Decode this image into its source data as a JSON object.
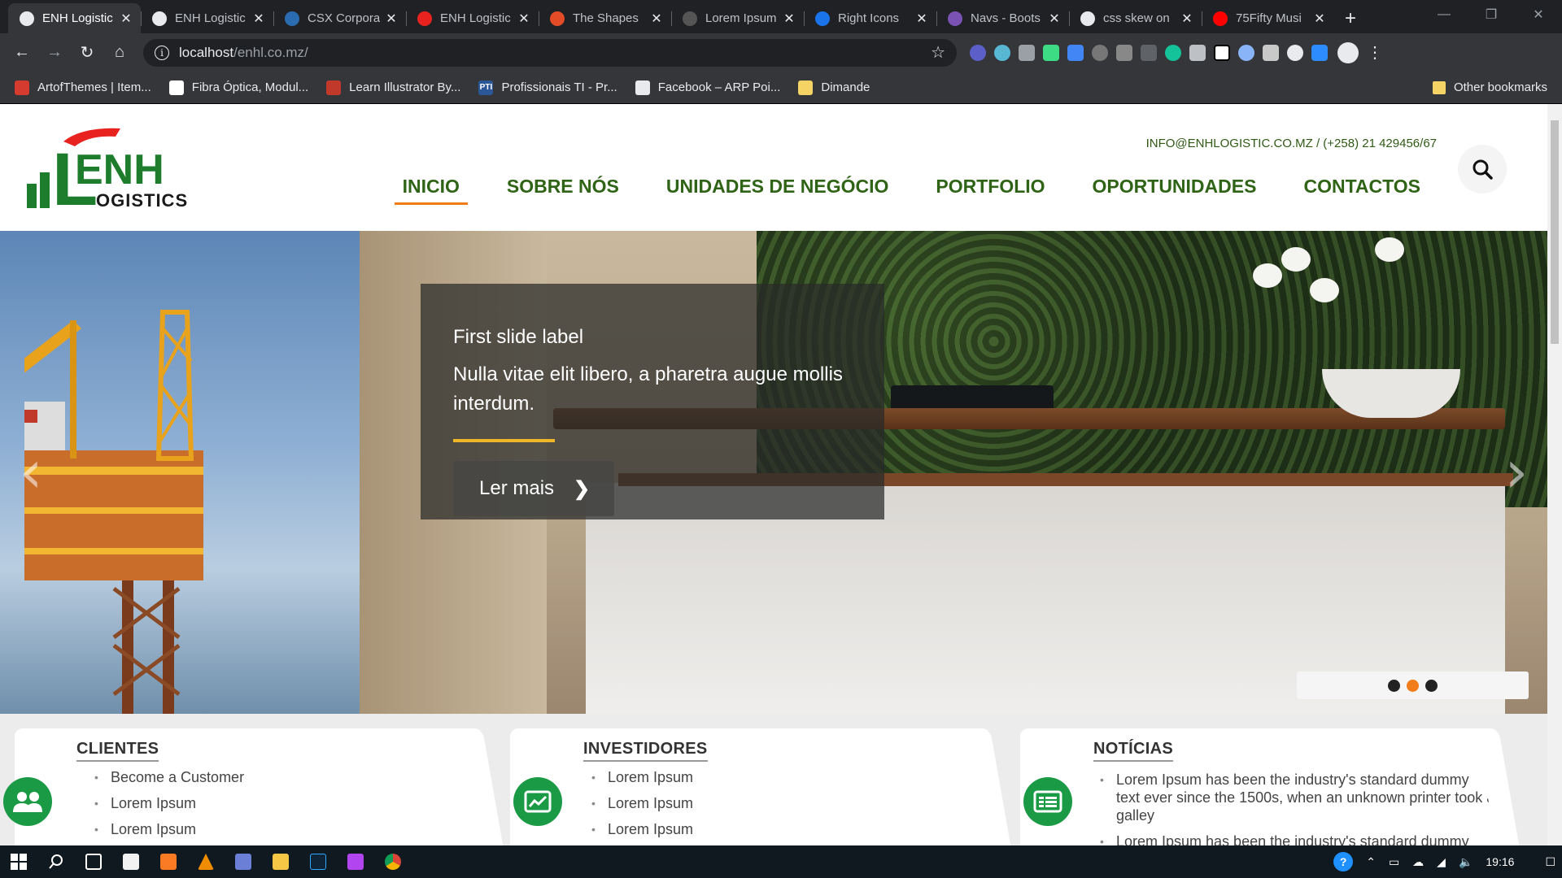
{
  "tabs": [
    {
      "title": "ENH Logistic",
      "active": true,
      "icon": "globe-icon"
    },
    {
      "title": "ENH Logistic",
      "active": false,
      "icon": "globe-icon"
    },
    {
      "title": "CSX Corpora",
      "active": false,
      "icon": "csx-icon"
    },
    {
      "title": "ENH Logistic",
      "active": false,
      "icon": "enh-flag-icon"
    },
    {
      "title": "The Shapes",
      "active": false,
      "icon": "shapes-icon"
    },
    {
      "title": "Lorem Ipsum",
      "active": false,
      "icon": "lorem-icon"
    },
    {
      "title": "Right Icons",
      "active": false,
      "icon": "flag-icon"
    },
    {
      "title": "Navs - Boots",
      "active": false,
      "icon": "bootstrap-icon"
    },
    {
      "title": "css skew on",
      "active": false,
      "icon": "codepen-icon"
    },
    {
      "title": "75Fifty Musi",
      "active": false,
      "icon": "youtube-icon"
    }
  ],
  "address": {
    "host": "localhost",
    "path": "/enhl.co.mz/"
  },
  "bookmarks": [
    {
      "label": "ArtofThemes | Item...",
      "color": "#d63b2f"
    },
    {
      "label": "Fibra Óptica, Modul...",
      "color": "#ffffff"
    },
    {
      "label": "Learn Illustrator By...",
      "color": "#c0392b"
    },
    {
      "label": "Profissionais TI - Pr...",
      "color": "#2b5797",
      "text": "PTI"
    },
    {
      "label": "Facebook – ARP Poi...",
      "color": "#e8eaed"
    },
    {
      "label": "Dimande",
      "color": "#f6d365"
    }
  ],
  "other_bookmarks": "Other bookmarks",
  "site": {
    "logo_text": "ENH",
    "logo_sub": "OGISTICS",
    "logo_L": "L",
    "contact": "INFO@ENHLOGISTIC.CO.MZ / (+258) 21 429456/67",
    "nav": [
      {
        "label": "INICIO",
        "active": true
      },
      {
        "label": "SOBRE NÓS",
        "active": false
      },
      {
        "label": "UNIDADES DE NEGÓCIO",
        "active": false
      },
      {
        "label": "PORTFOLIO",
        "active": false
      },
      {
        "label": "OPORTUNIDADES",
        "active": false
      },
      {
        "label": "CONTACTOS",
        "active": false
      }
    ]
  },
  "carousel": {
    "label": "First slide label",
    "text": "Nulla vitae elit libero, a pharetra augue mollis interdum.",
    "button": "Ler mais",
    "active_index": 1,
    "indicator_count": 3
  },
  "cards": {
    "clientes": {
      "title": "CLIENTES",
      "items": [
        "Become a Customer",
        "Lorem Ipsum",
        "Lorem Ipsum"
      ]
    },
    "investidores": {
      "title": "INVESTIDORES",
      "items": [
        "Lorem Ipsum",
        "Lorem Ipsum",
        "Lorem Ipsum"
      ]
    },
    "noticias": {
      "title": "NOTÍCIAS",
      "items": [
        "Lorem Ipsum has been the industry's standard dummy text ever since the 1500s, when an unknown printer took a galley",
        "Lorem Ipsum has been the industry's standard dummy text"
      ]
    }
  },
  "taskbar": {
    "time": "19:16"
  },
  "colors": {
    "brand_green": "#2f6416",
    "accent_orange": "#f07d1a",
    "icon_green": "#1a9a45",
    "caption_rule": "#f0b62a"
  }
}
